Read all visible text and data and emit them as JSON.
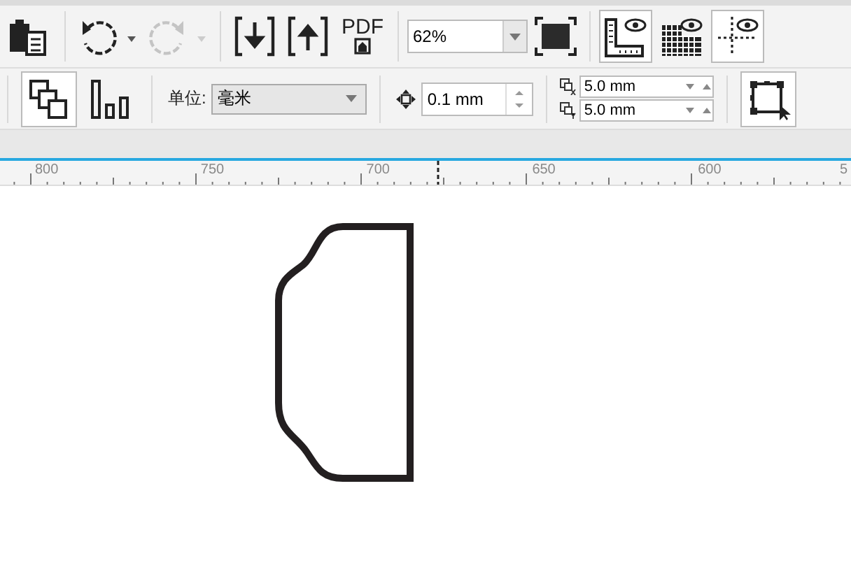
{
  "toolbar": {
    "undo_enabled": true,
    "redo_enabled": false,
    "pdf_label": "PDF",
    "zoom": "62%",
    "view_toggles": [
      {
        "kind": "rulers",
        "selected": true
      },
      {
        "kind": "grid",
        "selected": false
      },
      {
        "kind": "guidelines",
        "selected": true
      }
    ]
  },
  "property_bar": {
    "layout_toggles": [
      {
        "kind": "overlap",
        "selected": true
      },
      {
        "kind": "bars",
        "selected": false
      }
    ],
    "units_label": "单位:",
    "units": "毫米",
    "nudge": "0.1 mm",
    "duplicate_x": "5.0 mm",
    "duplicate_y": "5.0 mm"
  },
  "ruler": {
    "labels": [
      "800",
      "750",
      "700",
      "650",
      "600",
      "5"
    ]
  }
}
